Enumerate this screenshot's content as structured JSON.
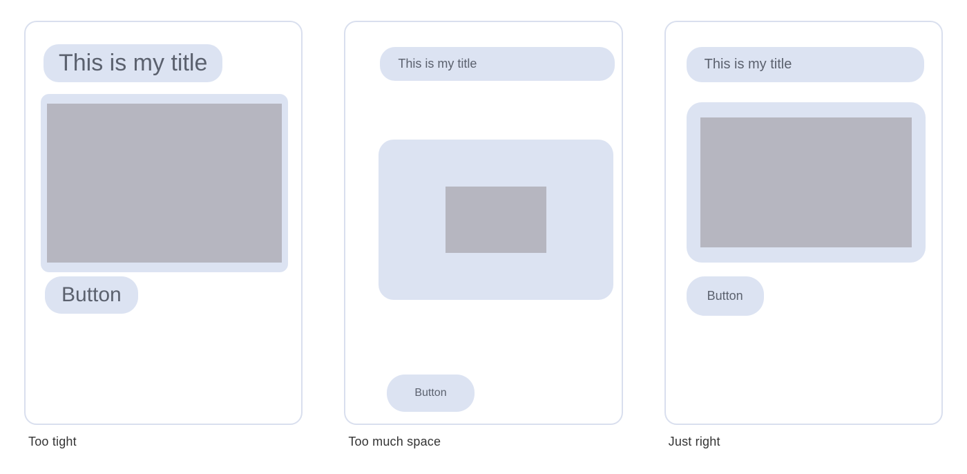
{
  "colors": {
    "pill_bg": "#DCE3F2",
    "pill_text": "#5B616E",
    "image_inner": "#B6B6C0",
    "frame_border": "#D9DFEE"
  },
  "examples": [
    {
      "id": "too-tight",
      "title": "This is my title",
      "button_label": "Button",
      "caption": "Too tight"
    },
    {
      "id": "too-much-space",
      "title": "This is my title",
      "button_label": "Button",
      "caption": "Too much space"
    },
    {
      "id": "just-right",
      "title": "This is my title",
      "button_label": "Button",
      "caption": "Just right"
    }
  ]
}
